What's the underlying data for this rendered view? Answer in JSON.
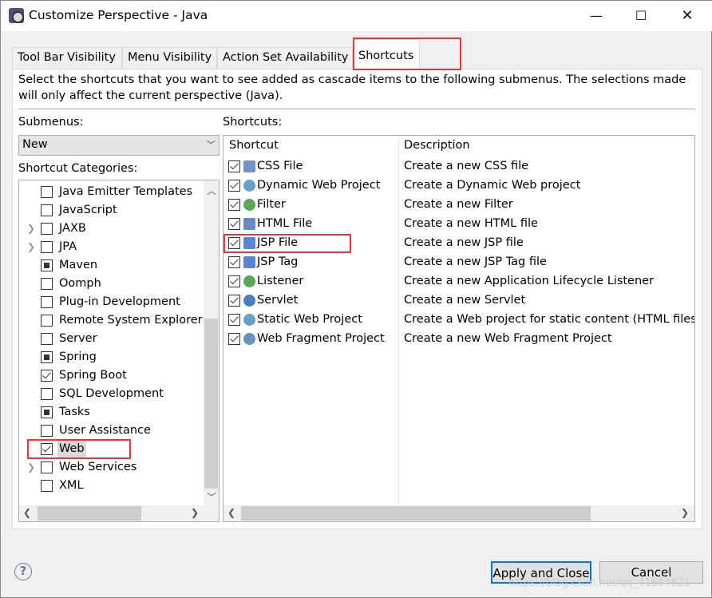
{
  "window": {
    "title": "Customize Perspective - Java",
    "controls": [
      "minimize",
      "maximize",
      "close"
    ]
  },
  "tabs": [
    {
      "label": "Tool Bar Visibility",
      "selected": false
    },
    {
      "label": "Menu Visibility",
      "selected": false
    },
    {
      "label": "Action Set Availability",
      "selected": false
    },
    {
      "label": "Shortcuts",
      "selected": true
    }
  ],
  "description_line1": "Select the shortcuts that you want to see added as cascade items to the following submenus.  The selections made",
  "description_line2": "will only affect the current perspective (Java).",
  "submenus": {
    "label": "Submenus:",
    "value": "New"
  },
  "categories": {
    "label": "Shortcut Categories:",
    "items": [
      {
        "label": "Java Emitter Templates",
        "state": "unchecked",
        "expandable": false
      },
      {
        "label": "JavaScript",
        "state": "unchecked",
        "expandable": false
      },
      {
        "label": "JAXB",
        "state": "unchecked",
        "expandable": true
      },
      {
        "label": "JPA",
        "state": "unchecked",
        "expandable": true
      },
      {
        "label": "Maven",
        "state": "partial",
        "expandable": false
      },
      {
        "label": "Oomph",
        "state": "unchecked",
        "expandable": false
      },
      {
        "label": "Plug-in Development",
        "state": "unchecked",
        "expandable": false
      },
      {
        "label": "Remote System Explorer",
        "state": "unchecked",
        "expandable": false
      },
      {
        "label": "Server",
        "state": "unchecked",
        "expandable": false
      },
      {
        "label": "Spring",
        "state": "partial",
        "expandable": false
      },
      {
        "label": "Spring Boot",
        "state": "checked",
        "expandable": false
      },
      {
        "label": "SQL Development",
        "state": "unchecked",
        "expandable": false
      },
      {
        "label": "Tasks",
        "state": "partial",
        "expandable": false
      },
      {
        "label": "User Assistance",
        "state": "unchecked",
        "expandable": false
      },
      {
        "label": "Web",
        "state": "checked",
        "expandable": false,
        "selected": true
      },
      {
        "label": "Web Services",
        "state": "unchecked",
        "expandable": true
      },
      {
        "label": "XML",
        "state": "unchecked",
        "expandable": false
      }
    ]
  },
  "shortcuts": {
    "label": "Shortcuts:",
    "columns": [
      "Shortcut",
      "Description"
    ],
    "rows": [
      {
        "name": "CSS File",
        "description": "Create a new CSS file",
        "icon": "css-file-icon",
        "checked": true
      },
      {
        "name": "Dynamic Web Project",
        "description": "Create a Dynamic Web project",
        "icon": "web-project-icon",
        "checked": true
      },
      {
        "name": "Filter",
        "description": "Create a new Filter",
        "icon": "filter-icon",
        "checked": true
      },
      {
        "name": "HTML File",
        "description": "Create a new HTML file",
        "icon": "html-file-icon",
        "checked": true
      },
      {
        "name": "JSP File",
        "description": "Create a new JSP file",
        "icon": "jsp-file-icon",
        "checked": true
      },
      {
        "name": "JSP Tag",
        "description": "Create a new JSP Tag file",
        "icon": "jsp-tag-icon",
        "checked": true
      },
      {
        "name": "Listener",
        "description": "Create a new Application Lifecycle Listener",
        "icon": "listener-icon",
        "checked": true
      },
      {
        "name": "Servlet",
        "description": "Create a new Servlet",
        "icon": "servlet-icon",
        "checked": true
      },
      {
        "name": "Static Web Project",
        "description": "Create a Web project for static content (HTML files)",
        "icon": "static-web-project-icon",
        "checked": true
      },
      {
        "name": "Web Fragment Project",
        "description": "Create a new Web Fragment Project",
        "icon": "web-fragment-project-icon",
        "checked": true
      }
    ]
  },
  "buttons": {
    "apply": "Apply and Close",
    "cancel": "Cancel"
  },
  "watermark": "https://blog.csdn.net/qq_41684621",
  "colors": {
    "highlight": "#e8363b",
    "default_button_border": "#0078d7"
  }
}
